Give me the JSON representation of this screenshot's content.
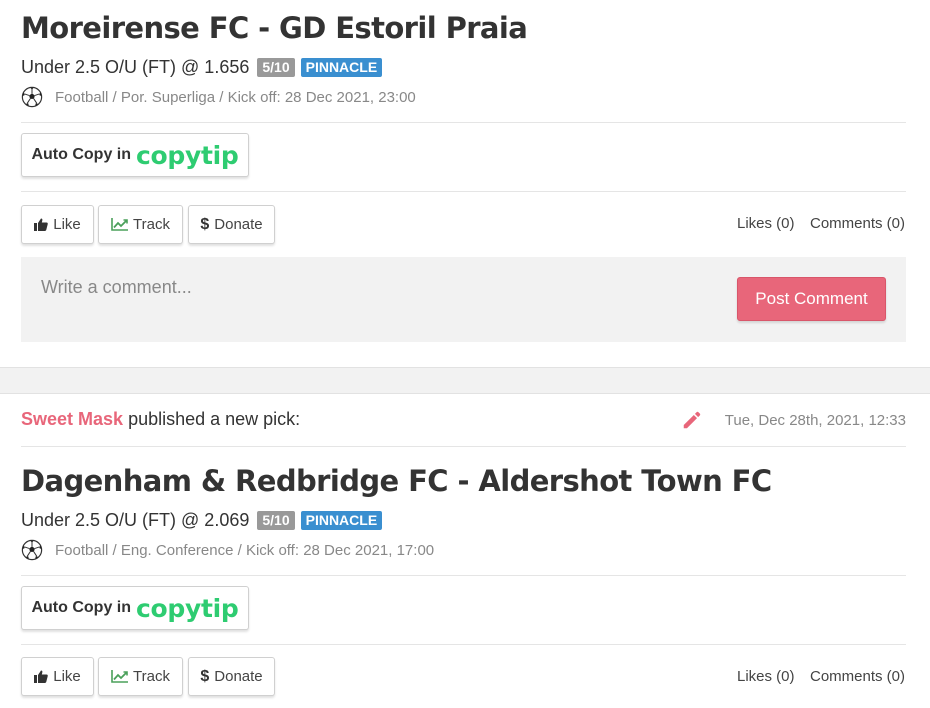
{
  "colors": {
    "accent": "#e8667a",
    "brand_green": "#2ecc71",
    "badge_gray": "#999999",
    "badge_blue": "#3a8fd0"
  },
  "pick1": {
    "title": "Moreirense FC - GD Estoril Praia",
    "market": "Under 2.5 O/U (FT) @ 1.656",
    "score": "5/10",
    "bookmaker": "PINNACLE",
    "meta": "Football / Por. Superliga / Kick off: 28 Dec 2021, 23:00",
    "sport_icon": "soccer-ball-icon",
    "copy_label": "Auto Copy in",
    "copy_brand": "copytip",
    "like_label": "Like",
    "track_label": "Track",
    "donate_label": "Donate",
    "likes_label": "Likes (0)",
    "comments_label": "Comments (0)",
    "comment_placeholder": "Write a comment...",
    "post_label": "Post Comment"
  },
  "feed_item2": {
    "user": "Sweet Mask",
    "action": " published a new pick:",
    "date": "Tue, Dec 28th, 2021, 12:33",
    "edit_icon": "pencil-icon"
  },
  "pick2": {
    "title": "Dagenham & Redbridge FC - Aldershot Town FC",
    "market": "Under 2.5 O/U (FT) @ 2.069",
    "score": "5/10",
    "bookmaker": "PINNACLE",
    "meta": "Football / Eng. Conference / Kick off: 28 Dec 2021, 17:00",
    "sport_icon": "soccer-ball-icon",
    "copy_label": "Auto Copy in",
    "copy_brand": "copytip",
    "like_label": "Like",
    "track_label": "Track",
    "donate_label": "Donate",
    "likes_label": "Likes (0)",
    "comments_label": "Comments (0)"
  }
}
